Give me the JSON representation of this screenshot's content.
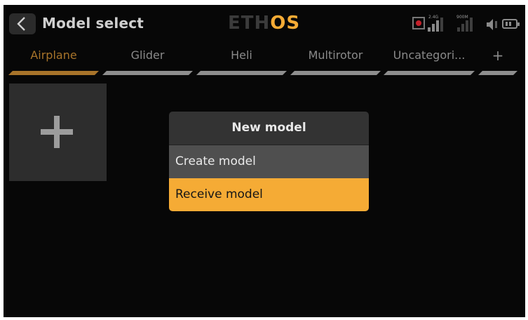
{
  "header": {
    "title": "Model select",
    "logo_part1": "ETH",
    "logo_part2": "OS",
    "signal_label_24": "2.4G",
    "signal_label_900": "900M"
  },
  "tabs": [
    {
      "label": "Airplane",
      "active": true
    },
    {
      "label": "Glider",
      "active": false
    },
    {
      "label": "Heli",
      "active": false
    },
    {
      "label": "Multirotor",
      "active": false
    },
    {
      "label": "Uncategori...",
      "active": false
    },
    {
      "label": "+",
      "active": false
    }
  ],
  "dialog": {
    "title": "New model",
    "items": [
      {
        "label": "Create model",
        "selected": false
      },
      {
        "label": "Receive model",
        "selected": true
      }
    ]
  },
  "colors": {
    "accent": "#f5ab35",
    "active_tab": "#a8742a",
    "background": "#070707",
    "record": "#c4202a"
  },
  "icons": [
    "back-arrow-icon",
    "record-icon",
    "signal-2.4g-icon",
    "signal-900m-icon",
    "speaker-icon",
    "battery-icon",
    "plus-icon"
  ]
}
